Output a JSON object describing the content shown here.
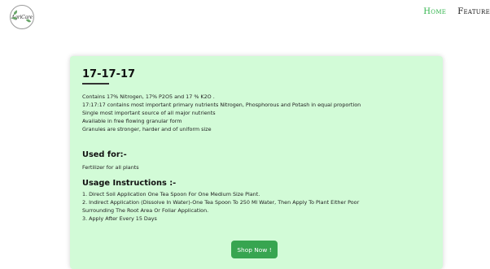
{
  "logo": {
    "text": "AgriCare"
  },
  "nav": {
    "items": [
      {
        "label": "Home",
        "active": true
      },
      {
        "label": "Feature",
        "active": false
      }
    ]
  },
  "product": {
    "title": "17-17-17",
    "description": [
      "Contains 17% Nitrogen, 17% P2O5 and 17 % K2O .",
      "17:17:17 contains most important primary nutrients Nitrogen, Phosphorous and Potash in equal proportion",
      "Single most important source of all major nutrients",
      "Available in free flowing granular form",
      "Granules are stronger, harder and of uniform size"
    ]
  },
  "used_for": {
    "heading": "Used for:-",
    "text": "Fertilizer for all plants"
  },
  "usage": {
    "heading": "Usage Instructions :-",
    "lines": [
      "1. Direct Soil Application One Tea Spoon For One Medium Size Plant.",
      "2. Indirect Application (Dissolve In Water)-One Tea Spoon To 250 Ml Water, Then Apply To Plant Either Poor",
      "Surrounding The Root Area Or Foliar Application.",
      "3. Apply After Every 15 Days"
    ]
  },
  "cta": {
    "label": "Shop Now !"
  },
  "colors": {
    "accent": "#37a550",
    "nav_active": "#2fb34a",
    "card_bg": "#d2fbd7"
  }
}
